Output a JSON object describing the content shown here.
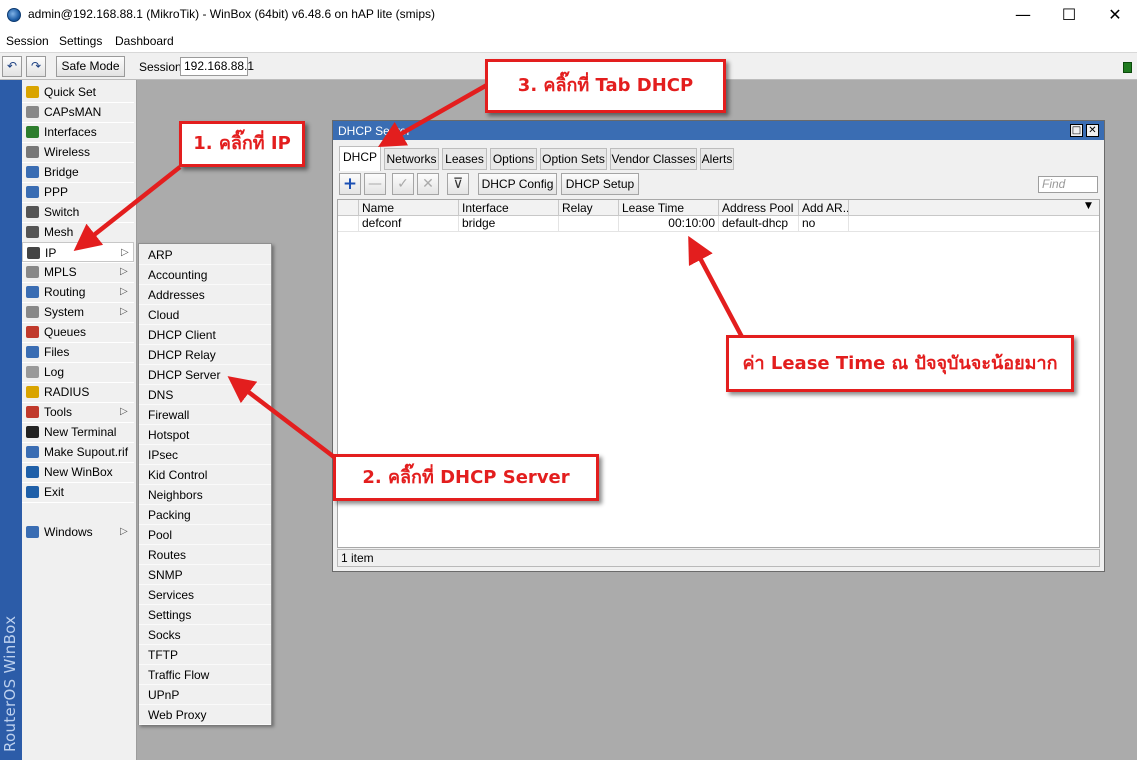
{
  "window": {
    "title": "admin@192.168.88.1 (MikroTik) - WinBox (64bit) v6.48.6 on hAP lite (smips)",
    "minimize": "—",
    "maximize": "☐",
    "close": "✕"
  },
  "menubar": {
    "items": [
      "Session",
      "Settings",
      "Dashboard"
    ]
  },
  "toolbar": {
    "undo": "↶",
    "redo": "↷",
    "safe_mode": "Safe Mode",
    "session_label": "Session:",
    "session_value": "192.168.88.1"
  },
  "brand": "RouterOS WinBox",
  "sidebar": {
    "items": [
      {
        "label": "Quick Set",
        "icon": "wand-icon",
        "color": "#d9a400"
      },
      {
        "label": "CAPsMAN",
        "icon": "antenna-icon",
        "color": "#888888"
      },
      {
        "label": "Interfaces",
        "icon": "interfaces-icon",
        "color": "#2d7d2d"
      },
      {
        "label": "Wireless",
        "icon": "wireless-icon",
        "color": "#777777"
      },
      {
        "label": "Bridge",
        "icon": "bridge-icon",
        "color": "#3a6db3"
      },
      {
        "label": "PPP",
        "icon": "ppp-icon",
        "color": "#3a6db3"
      },
      {
        "label": "Switch",
        "icon": "switch-icon",
        "color": "#555555"
      },
      {
        "label": "Mesh",
        "icon": "mesh-icon",
        "color": "#555555"
      },
      {
        "label": "IP",
        "icon": "ip-icon",
        "color": "#444444",
        "arrow": "▷"
      },
      {
        "label": "MPLS",
        "icon": "mpls-icon",
        "color": "#888888",
        "arrow": "▷"
      },
      {
        "label": "Routing",
        "icon": "routing-icon",
        "color": "#3a6db3",
        "arrow": "▷"
      },
      {
        "label": "System",
        "icon": "system-icon",
        "color": "#888888",
        "arrow": "▷"
      },
      {
        "label": "Queues",
        "icon": "queues-icon",
        "color": "#c0392b"
      },
      {
        "label": "Files",
        "icon": "files-icon",
        "color": "#3a6db3"
      },
      {
        "label": "Log",
        "icon": "log-icon",
        "color": "#999999"
      },
      {
        "label": "RADIUS",
        "icon": "radius-icon",
        "color": "#d9a400"
      },
      {
        "label": "Tools",
        "icon": "tools-icon",
        "color": "#c0392b",
        "arrow": "▷"
      },
      {
        "label": "New Terminal",
        "icon": "terminal-icon",
        "color": "#222222"
      },
      {
        "label": "Make Supout.rif",
        "icon": "supout-icon",
        "color": "#3a6db3"
      },
      {
        "label": "New WinBox",
        "icon": "winbox-icon",
        "color": "#1f5fa8"
      },
      {
        "label": "Exit",
        "icon": "exit-icon",
        "color": "#1f5fa8"
      }
    ],
    "windows": {
      "label": "Windows",
      "icon": "windows-icon",
      "color": "#3a6db3",
      "arrow": "▷"
    }
  },
  "ip_submenu": [
    "ARP",
    "Accounting",
    "Addresses",
    "Cloud",
    "DHCP Client",
    "DHCP Relay",
    "DHCP Server",
    "DNS",
    "Firewall",
    "Hotspot",
    "IPsec",
    "Kid Control",
    "Neighbors",
    "Packing",
    "Pool",
    "Routes",
    "SNMP",
    "Services",
    "Settings",
    "Socks",
    "TFTP",
    "Traffic Flow",
    "UPnP",
    "Web Proxy"
  ],
  "dhcp_window": {
    "title": "DHCP Server",
    "tabs": [
      "DHCP",
      "Networks",
      "Leases",
      "Options",
      "Option Sets",
      "Vendor Classes",
      "Alerts"
    ],
    "toolbar": {
      "add": "+",
      "remove": "—",
      "enable": "✓",
      "disable": "✕",
      "filter": "⊽",
      "dhcp_config": "DHCP Config",
      "dhcp_setup": "DHCP Setup",
      "find_placeholder": "Find"
    },
    "columns": [
      "Name",
      "Interface",
      "Relay",
      "Lease Time",
      "Address Pool",
      "Add AR..."
    ],
    "rows": [
      {
        "name": "defconf",
        "interface": "bridge",
        "relay": "",
        "lease_time": "00:10:00",
        "address_pool": "default-dhcp",
        "add_arp": "no"
      }
    ],
    "status": "1 item"
  },
  "annotations": {
    "step1": "1. คลิ๊กที่ IP",
    "step2": "2. คลิ๊กที่ DHCP Server",
    "step3": "3. คลิ๊กที่ Tab DHCP",
    "note": "ค่า Lease Time ณ ปัจจุบันจะน้อยมาก",
    "color": "#e31e1e"
  }
}
